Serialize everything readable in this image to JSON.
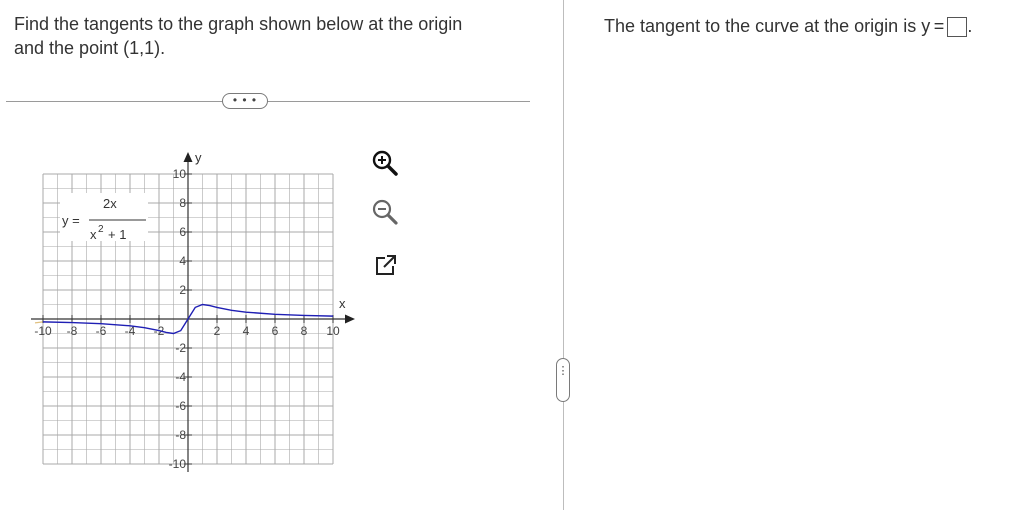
{
  "question": {
    "line1": "Find the tangents to the graph shown below at the origin",
    "line2": "and the point (1,1)."
  },
  "more_button": "• • •",
  "side_handle": "⋮",
  "answer": {
    "prefix": "The tangent to the curve at the origin is y =",
    "suffix": "."
  },
  "graph": {
    "axis_x_label": "x",
    "axis_y_label": "y",
    "equation": {
      "lhs": "y =",
      "numerator": "2x",
      "denominator_base": "x",
      "denominator_exp": "2",
      "denominator_rest": "+ 1"
    },
    "x_ticks": [
      "-10",
      "-8",
      "-6",
      "-4",
      "-2",
      "2",
      "4",
      "6",
      "8",
      "10"
    ],
    "y_ticks": [
      "10",
      "8",
      "6",
      "4",
      "2",
      "-2",
      "-4",
      "-6",
      "-8",
      "-10"
    ],
    "curve_color": "#1f1fb4"
  },
  "tools": [
    "zoom-in-icon",
    "zoom-out-icon",
    "expand-icon"
  ],
  "chart_data": {
    "type": "line",
    "title": "",
    "xlabel": "x",
    "ylabel": "y",
    "xlim": [
      -10,
      10
    ],
    "ylim": [
      -10,
      10
    ],
    "grid": true,
    "series": [
      {
        "name": "y = 2x/(x^2 + 1)",
        "x": [
          -10,
          -8,
          -6,
          -4,
          -3,
          -2,
          -1.5,
          -1,
          -0.5,
          0,
          0.5,
          1,
          1.5,
          2,
          3,
          4,
          6,
          8,
          10
        ],
        "y": [
          -0.198,
          -0.246,
          -0.324,
          -0.471,
          -0.6,
          -0.8,
          -0.923,
          -1,
          -0.8,
          0,
          0.8,
          1,
          0.923,
          0.8,
          0.6,
          0.471,
          0.324,
          0.246,
          0.198
        ]
      }
    ]
  }
}
